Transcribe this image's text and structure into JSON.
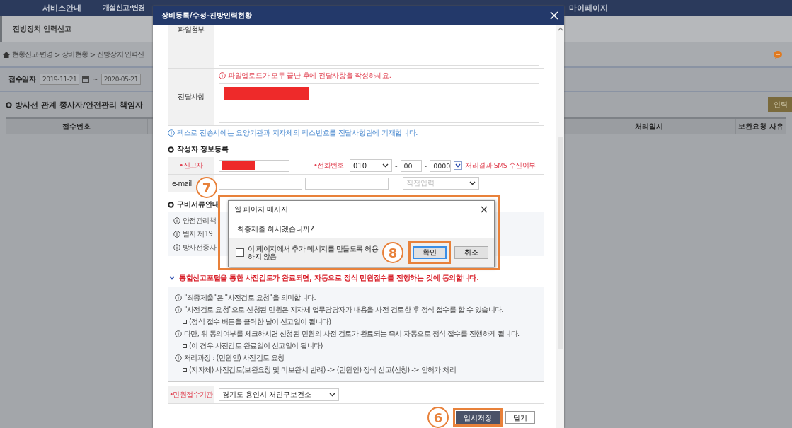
{
  "topnav": {
    "items": [
      {
        "label": "서비스안내"
      },
      {
        "label": "개설신고·변경"
      },
      {
        "label": "마이페이지"
      }
    ]
  },
  "page": {
    "title": "진방장치 인력신고",
    "breadcrumb": [
      "현황신고·변경",
      "장비현황",
      "진방장치 인력신"
    ],
    "breadcrumb_separator": ">",
    "date_filter": {
      "label": "접수일자",
      "from": "2019-11-21",
      "separator": "~",
      "to": "2020-05-21"
    },
    "section_title": "방사선 관계 종사자/안전관리 책임자",
    "action_button": "인력",
    "table": {
      "columns": [
        "접수번호",
        "처리일시",
        "보완요청 사유"
      ]
    }
  },
  "modal": {
    "title": "장비등록/수정-진방인력현황",
    "file_label": "파일첨부",
    "message_label": "전달사항",
    "upload_note": "파일업로드가 모두 끝난 후에 전달사항을 작성하세요.",
    "fax_note": "팩스로 전송시에는 요양기관과 지자체의 팩스번호를 전달사항란에 기재합니다.",
    "writer_heading": "작성자 정보등록",
    "reporter_label": "•신고자",
    "phone_label": "•전화번호",
    "phone": [
      "010",
      "00",
      "0000"
    ],
    "phone_separator": "-",
    "sms": {
      "label": "처리결과 SMS 수신여부",
      "checked": true
    },
    "email_label": "e-mail",
    "email_domain": "직접입력",
    "docs_heading": "구비서류안내",
    "docs_notes": [
      "안전관리책",
      "별지 제19",
      "방사선종사"
    ],
    "agreement": {
      "label": "통합신고포털을 통한 사전검토가 완료되면, 자동으로 정식 민원접수를 진행하는 것에 동의합니다.",
      "checked": true
    },
    "info_lines": [
      {
        "kind": "note",
        "text": "\"최종제출\"은 \"사전검토 요청\"을 의미합니다."
      },
      {
        "kind": "note",
        "text": "\"사전검토 요청\"으로 신청된 민원은 지자체 업무담당자가 내용을 사전 검토한 후 정식 접수를 할 수 있습니다."
      },
      {
        "kind": "sub",
        "text": "(정식 접수 버튼을 클릭한 날이 신고일이 됩니다)"
      },
      {
        "kind": "note",
        "text": "다만, 위 동의여부를 체크하시면 신청된 민원의 사전 검토가 완료되는 즉시 자동으로 정식 접수를 진행하게 됩니다."
      },
      {
        "kind": "sub",
        "text": "(이 경우 사전검토 완료일이 신고일이 됩니다)"
      },
      {
        "kind": "note",
        "text": "처리과정 : (민원인) 사전검토 요청"
      },
      {
        "kind": "sub",
        "text": "(지자체) 사전검토(보완요청 및 미보완시 반려) -> (민원인) 정식 신고(신청) -> 인허가 처리"
      }
    ],
    "agency_label": "•민원접수기관",
    "agency": "경기도 용인시 처인구보건소",
    "buttons": [
      {
        "label": "임시저장",
        "kind": "primary"
      },
      {
        "label": "닫기",
        "kind": "plain"
      }
    ]
  },
  "dialog": {
    "title": "웹 페이지 메시지",
    "message": "최종제출 하시겠습니까?",
    "suppress": {
      "label": "이 페이지에서 추가 메시지를 만들도록 허용하지 않음",
      "checked": false
    },
    "buttons": [
      {
        "label": "확인",
        "focused": true
      },
      {
        "label": "취소",
        "focused": false
      }
    ]
  },
  "annotations": [
    {
      "number": "7"
    },
    {
      "number": "8"
    },
    {
      "number": "6"
    }
  ]
}
